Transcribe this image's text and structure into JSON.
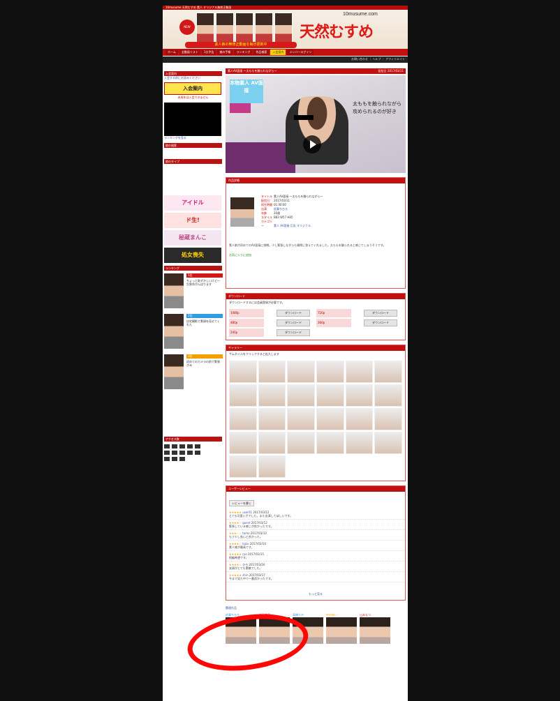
{
  "header": {
    "strip_text": "10musume 天然むすめ 素人 オリジナル無修正動画",
    "logo_text": "天然むすめ",
    "logo_url": "10musume.com",
    "banner_text": "素人娘の無修正動画を毎日更新中",
    "badge_text": "NEW"
  },
  "nav": {
    "items": [
      "ホーム",
      "全動画リスト",
      "1分予告",
      "娘の手帳",
      "ランキング",
      "作品検索",
      "入会案内",
      "メンバーログイン"
    ],
    "active_index": 6
  },
  "login_bar": "お問い合わせ ｜ ヘルプ ｜ アフィリエイト",
  "sidebar": {
    "member_title": "入会案内",
    "member_link": "入会する前にお読みください",
    "join_button": "入会案内",
    "join_sub": "未成年は入会できません",
    "ranking_link": "ランキングを見る",
    "search_title": "娘の検索",
    "genre_title": "娘のタイプ",
    "rank_title": "ランキング",
    "ranks": [
      {
        "no": "1位",
        "color": "#d01818",
        "text": "ちょっと恥ずかしいけど一生懸命がんばります"
      },
      {
        "no": "2位",
        "color": "#2e9ee0",
        "text": "自宅撮影で素顔を見せてくれた"
      },
      {
        "no": "3位",
        "color": "#f2a000",
        "text": "初めてのカメラの前で緊張ぎみ"
      }
    ],
    "banners": [
      "アイドル",
      "ド生!",
      "秘蔵まんこ",
      "処女喪失"
    ],
    "numbers_title": "アクセス数",
    "colors": {
      "accent": "#c11010",
      "banner_yellow": "#ffe44d"
    }
  },
  "main": {
    "title": "素人AV面接 ～太ももを触られながら～",
    "date": "配信日 2017/03/11",
    "video_sign": "本物素人 AV面接",
    "video_text": "太ももを触られながら 攻められるのが好き",
    "info_title": "作品詳細",
    "info_rows": [
      {
        "k": "タイトル",
        "v": "素人AV面接 ～太ももを触られながら～"
      },
      {
        "k": "配信日",
        "v": "2017/03/11"
      },
      {
        "k": "再生時間",
        "v": "01:00:00"
      },
      {
        "k": "出演",
        "v": "佐藤ちひろ"
      },
      {
        "k": "年齢",
        "v": "20歳"
      },
      {
        "k": "スタイル",
        "v": "B83 W57 H85"
      },
      {
        "k": "カテゴリー",
        "v": "素人 AV面接 巨乳 オリジナル"
      }
    ],
    "description": "素人娘が初めてのAV面接に挑戦。少し緊張しながらも質問に答えてくれました。太ももを触られると感じてしまうそうです。",
    "fav_label": "お気に入りに追加",
    "download_title": "ダウンロード",
    "download_note": "ダウンロードするには会員登録が必要です。",
    "downloads": [
      {
        "label": "1080p",
        "btn": "ダウンロード"
      },
      {
        "label": "720p",
        "btn": "ダウンロード"
      },
      {
        "label": "480p",
        "btn": "ダウンロード"
      },
      {
        "label": "360p",
        "btn": "ダウンロード"
      },
      {
        "label": "240p",
        "btn": "ダウンロード"
      }
    ],
    "gallery_title": "ギャラリー",
    "gallery_note": "サムネイルをクリックすると拡大します",
    "gallery_count": 26,
    "review_title": "ユーザーレビュー",
    "review_button": "レビューを書く",
    "reviews": [
      {
        "stars": "★★★★★",
        "user": "user01",
        "date": "2017/03/12",
        "text": "とても可愛い子でした。また出演してほしいです。"
      },
      {
        "stars": "★★★★☆",
        "user": "guest",
        "date": "2017/03/12",
        "text": "緊張している感じが良かったです。"
      },
      {
        "stars": "★★★☆☆",
        "user": "tomo",
        "date": "2017/03/13",
        "text": "もう少し長いと良かった。"
      },
      {
        "stars": "★★★★☆",
        "user": "kazu",
        "date": "2017/03/14",
        "text": "素人感が最高です。"
      },
      {
        "stars": "★★★★★",
        "user": "ryo",
        "date": "2017/03/15",
        "text": "続編希望です。"
      },
      {
        "stars": "★★★★☆",
        "user": "ひろ",
        "date": "2017/03/16",
        "text": "笑顔がとても素敵でした。"
      },
      {
        "stars": "★★★★★",
        "user": "shin",
        "date": "2017/03/17",
        "text": "今まで見た中で一番良かったです。"
      }
    ],
    "more_reviews": "もっと見る",
    "others_title": "関連作品",
    "others": [
      "佐藤ちひろ",
      "吉岡美優",
      "高橋りか",
      "中村あい",
      "山本なつ"
    ]
  }
}
